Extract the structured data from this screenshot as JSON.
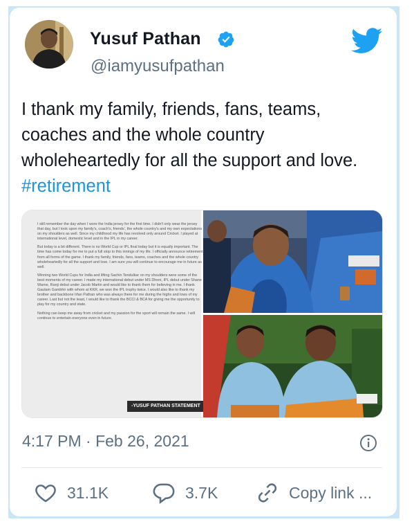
{
  "tweet": {
    "author_name": "Yusuf Pathan",
    "author_handle": "@iamyusufpathan",
    "text_main": "I thank my family, friends, fans, teams, coaches and the whole country wholeheartedly for all the support and love. ",
    "hashtag": "#retirement",
    "timestamp": "4:17 PM · Feb 26, 2021",
    "likes": "31.1K",
    "replies": "3.7K",
    "copy_link_label": "Copy link ..."
  },
  "statement": {
    "paragraphs": [
      "I still remember the day when I wore the India jersey for the first time. I didn't only wear the jersey that day, but I took upon my family's, coach's, friends', the whole country's and my own expectations on my shoulders as well. Since my childhood my life has revolved only around Cricket. I played at international level, domestic level and in the IPL in my career.",
      "But today is a bit different. There is no World Cup or IPL final today but it is equally important. The time has come today for me to put a full stop to this innings of my life. I officially announce retirement from all forms of the game. I thank my family, friends, fans, teams, coaches and the whole country wholeheartedly for all the support and love. I am sure you will continue to encourage me in future as well.",
      "Winning two World Cups for India and lifting Sachin Tendulkar on my shoulders were some of the best moments of my career. I made my international debut under MS Dhoni, IPL debut under Shane Warne, Ranji debut under Jacob Martin and would like to thank them for believing in me. I thank Gautam Gambhir with whom at KKR, we won the IPL trophy twice. I would also like to thank my brother and backbone Irfan Pathan who was always there for me during the highs and lows of my career. Last but not the least, I would like to thank the BCCI & BCA for giving me the opportunity to play for my country and state.",
      "Nothing can keep me away from cricket and my passion for the sport will remain the same. I will continue to entertain everyone even in future."
    ],
    "signature": "-YUSUF PATHAN STATEMENT"
  },
  "icons": {
    "verified": "verified-badge-icon",
    "brand": "twitter-bird-icon",
    "info": "info-icon",
    "like": "heart-icon",
    "reply": "reply-bubble-icon",
    "share": "link-icon"
  },
  "colors": {
    "accent": "#1da1f2",
    "hashtag": "#1b95e0",
    "text": "#141823",
    "muted": "#5b7083"
  }
}
